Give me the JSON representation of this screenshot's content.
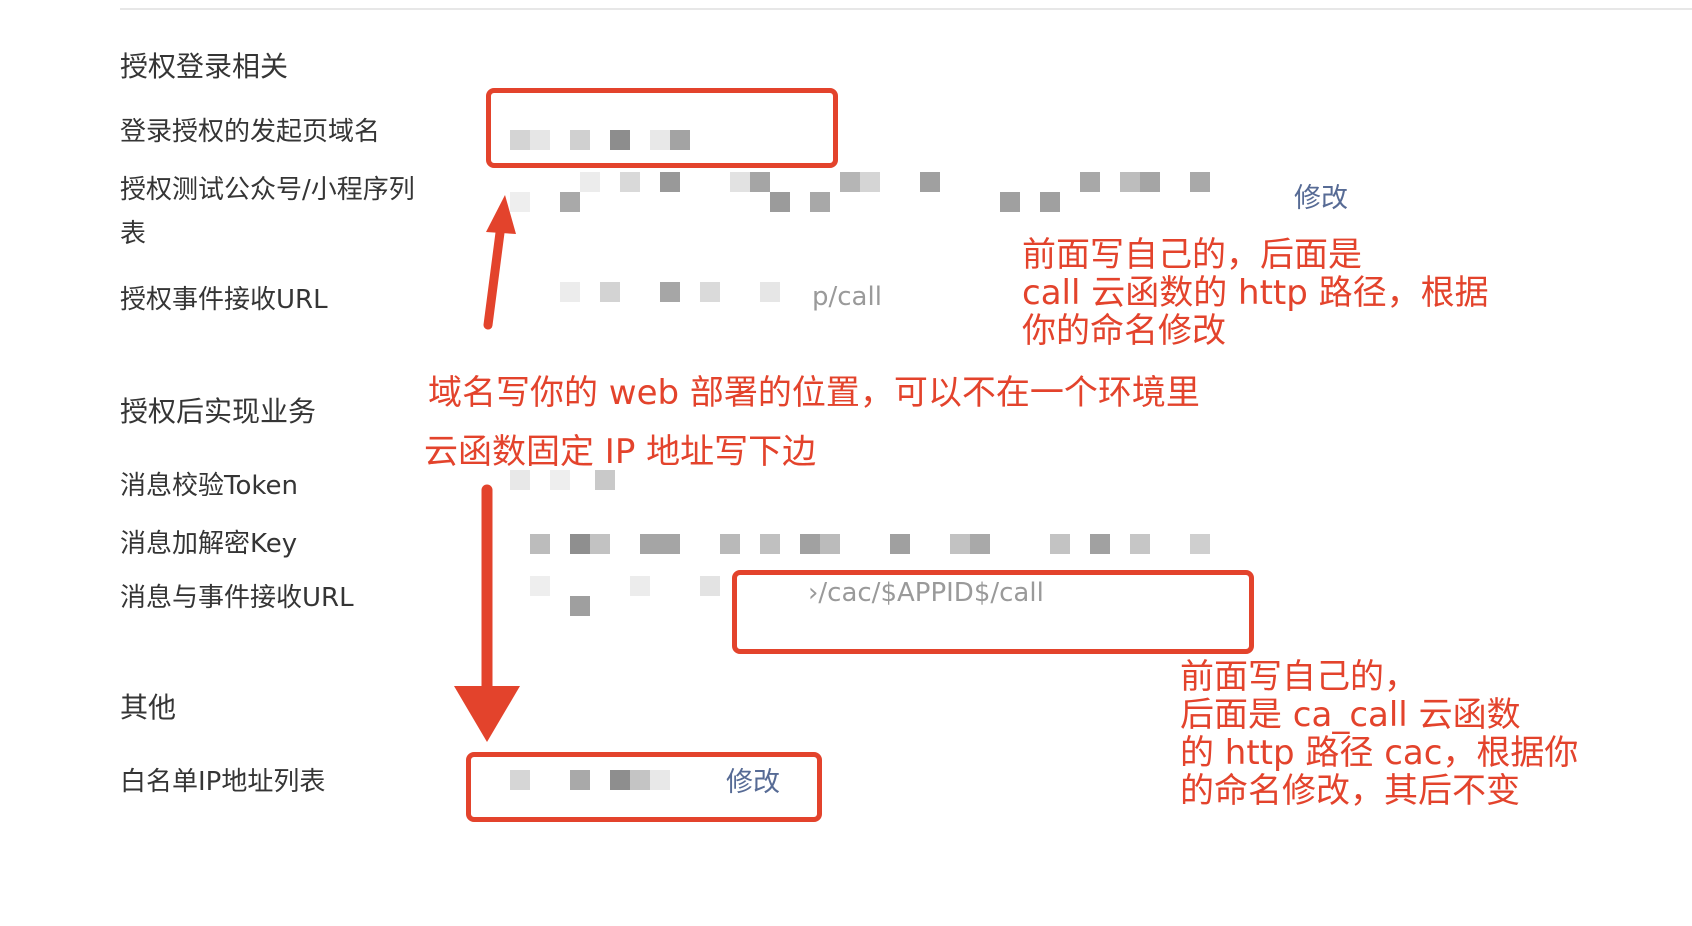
{
  "sections": {
    "auth_login": "授权登录相关",
    "auth_business": "授权后实现业务",
    "other": "其他"
  },
  "fields": {
    "login_domain_label": "登录授权的发起页域名",
    "test_accounts_label_line1": "授权测试公众号/小程序列",
    "test_accounts_label_line2": "表",
    "test_accounts_edit": "修改",
    "auth_event_url_label": "授权事件接收URL",
    "auth_event_url_value": "p/call",
    "token_label": "消息校验Token",
    "aes_key_label": "消息加解密Key",
    "msg_event_url_label": "消息与事件接收URL",
    "msg_event_url_value": "›/cac/$APPID$/call",
    "whitelist_label": "白名单IP地址列表",
    "whitelist_edit": "修改"
  },
  "annotations": {
    "note_top_right": "前面写自己的，后面是\ncall 云函数的 http 路径，根据\n你的命名修改",
    "note_domain": "域名写你的 web 部署的位置，可以不在一个环境里",
    "note_ip": "云函数固定 IP 地址写下边",
    "note_bottom_right": "前面写自己的，\n后面是 ca_call 云函数\n的 http 路径 cac，根据你\n的命名修改，其后不变"
  },
  "colors": {
    "annotation_red": "#e3432c",
    "link_blue": "#576b95",
    "label_text": "#353535"
  }
}
